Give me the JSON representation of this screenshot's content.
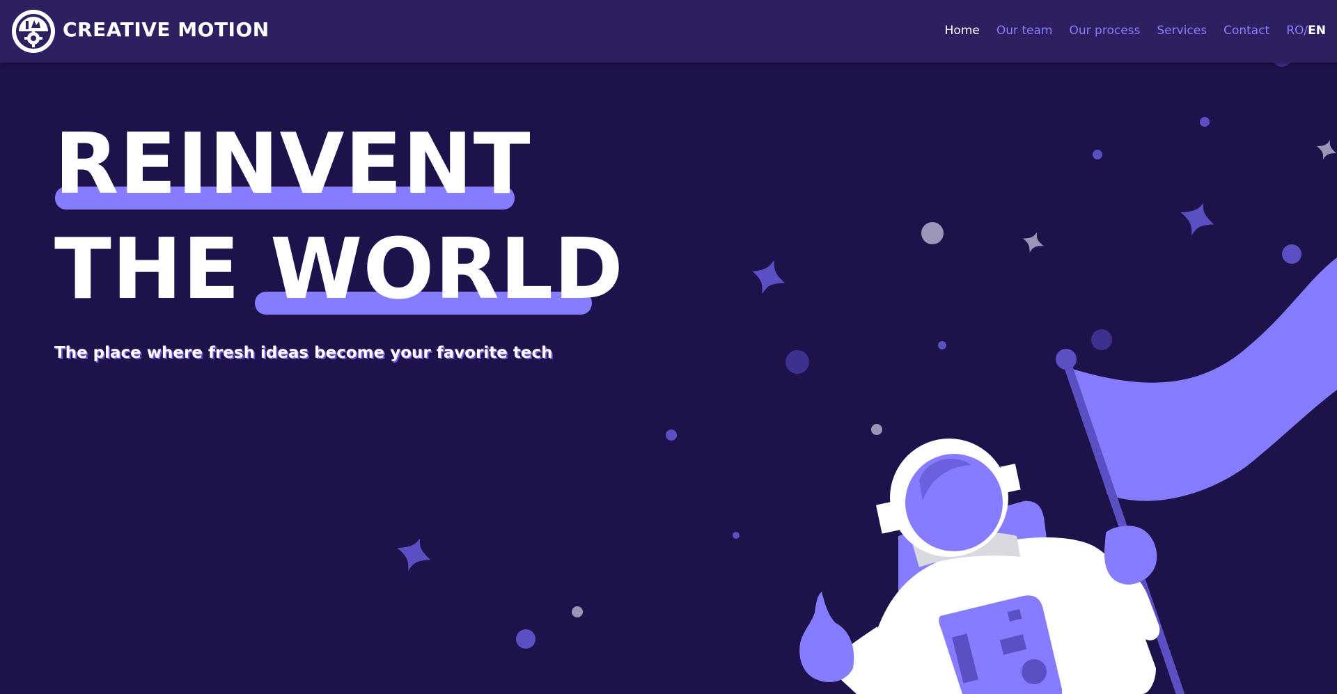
{
  "brand": {
    "name": "CREATIVE MOTION",
    "logo_icon": "gear-film-logo-icon"
  },
  "nav": {
    "items": [
      {
        "label": "Home",
        "active": true
      },
      {
        "label": "Our team",
        "active": false
      },
      {
        "label": "Our process",
        "active": false
      },
      {
        "label": "Services",
        "active": false
      },
      {
        "label": "Contact",
        "active": false
      }
    ],
    "lang": {
      "other": "RO",
      "sep": "/",
      "current": "EN"
    }
  },
  "hero": {
    "line1": "REINVENT",
    "line2_a": "THE",
    "line2_b": "WORLD",
    "subtitle": "The place where fresh ideas become your favorite tech"
  },
  "illustration": {
    "name": "astronaut-with-flag",
    "icons": [
      "astronaut-icon",
      "flag-icon",
      "star-icon",
      "planet-dot-icon"
    ]
  },
  "colors": {
    "background": "#1e124b",
    "navbar": "#2d1f60",
    "accent": "#857cff",
    "nav_link": "#8b7fff",
    "text": "#ffffff"
  }
}
